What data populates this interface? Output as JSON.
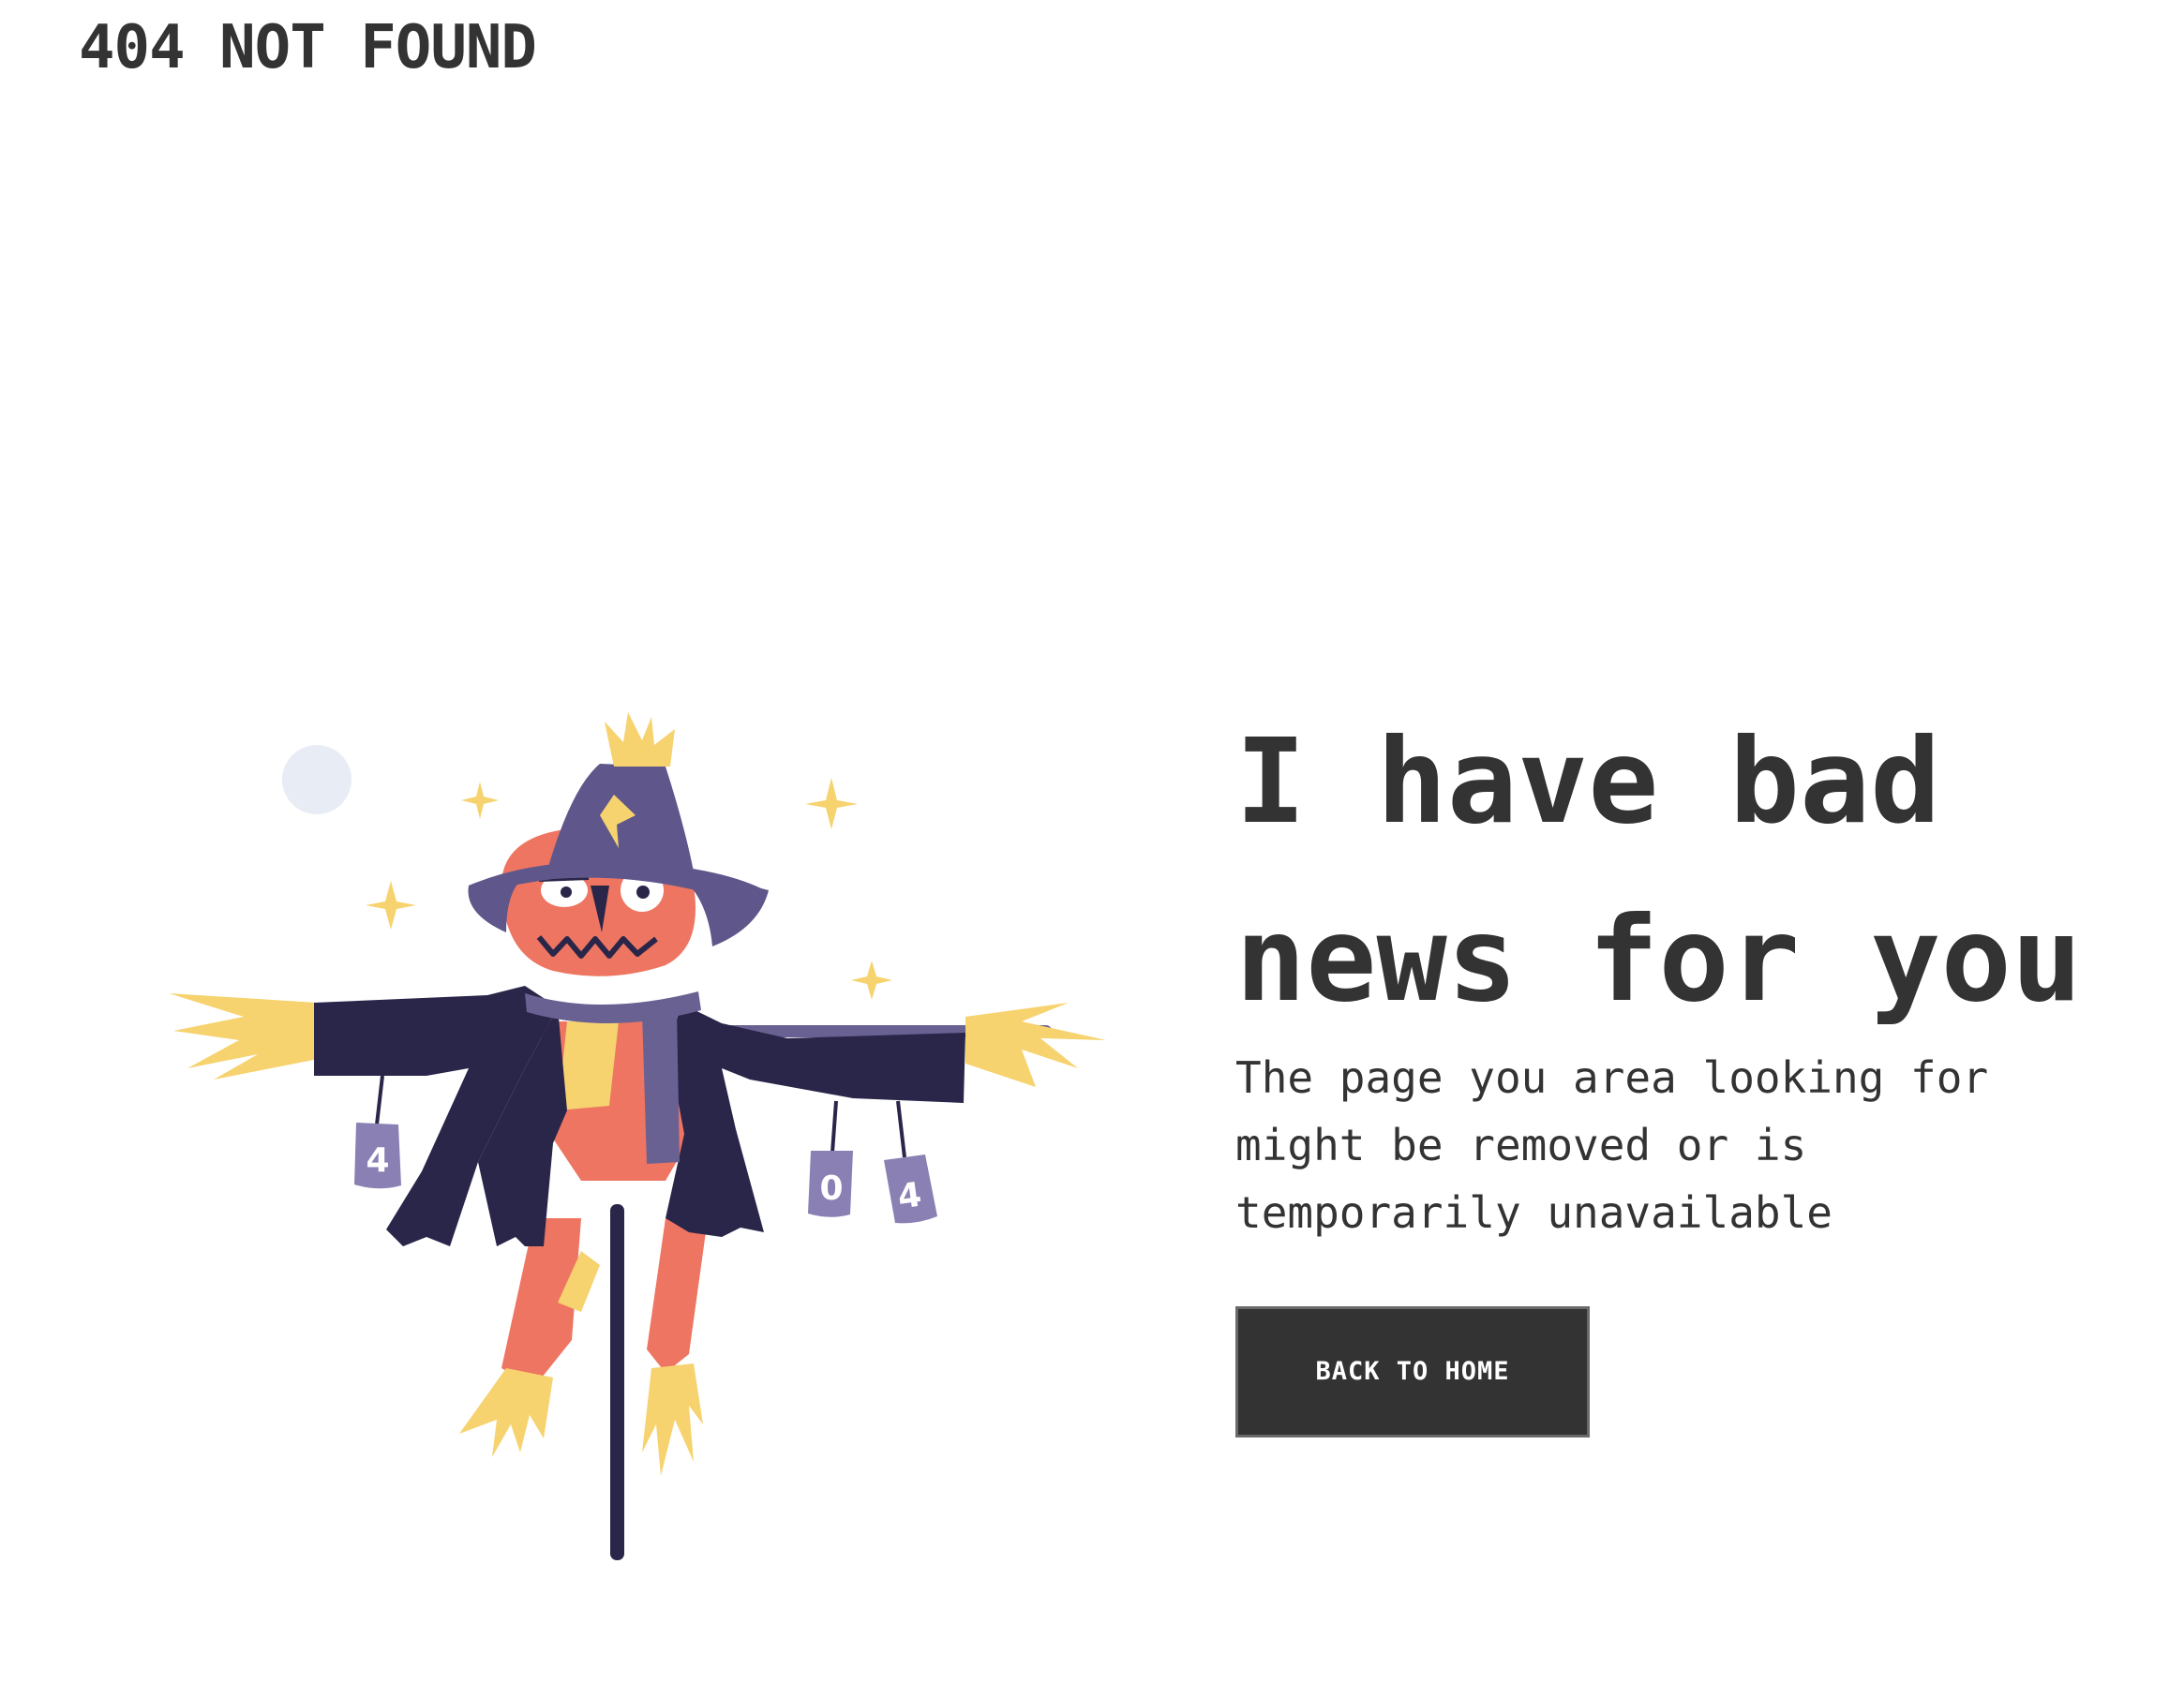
{
  "header": {
    "title": "404 NOT FOUND"
  },
  "main": {
    "headline": "I have bad news for you",
    "message": "The page you area looking for might be removed or is temporarily unavailable",
    "button_label": "BACK TO HOME"
  },
  "illustration": {
    "subject": "scarecrow-illustration",
    "can_labels": [
      "4",
      "0",
      "4"
    ]
  },
  "colors": {
    "text": "#333333",
    "button_bg": "#333333",
    "button_text": "#ffffff",
    "hat": "#5f578b",
    "coat": "#29264a",
    "face": "#ee7561",
    "straw": "#f6d36f",
    "scarf": "#6a6193",
    "moon": "#e8ecf4"
  }
}
